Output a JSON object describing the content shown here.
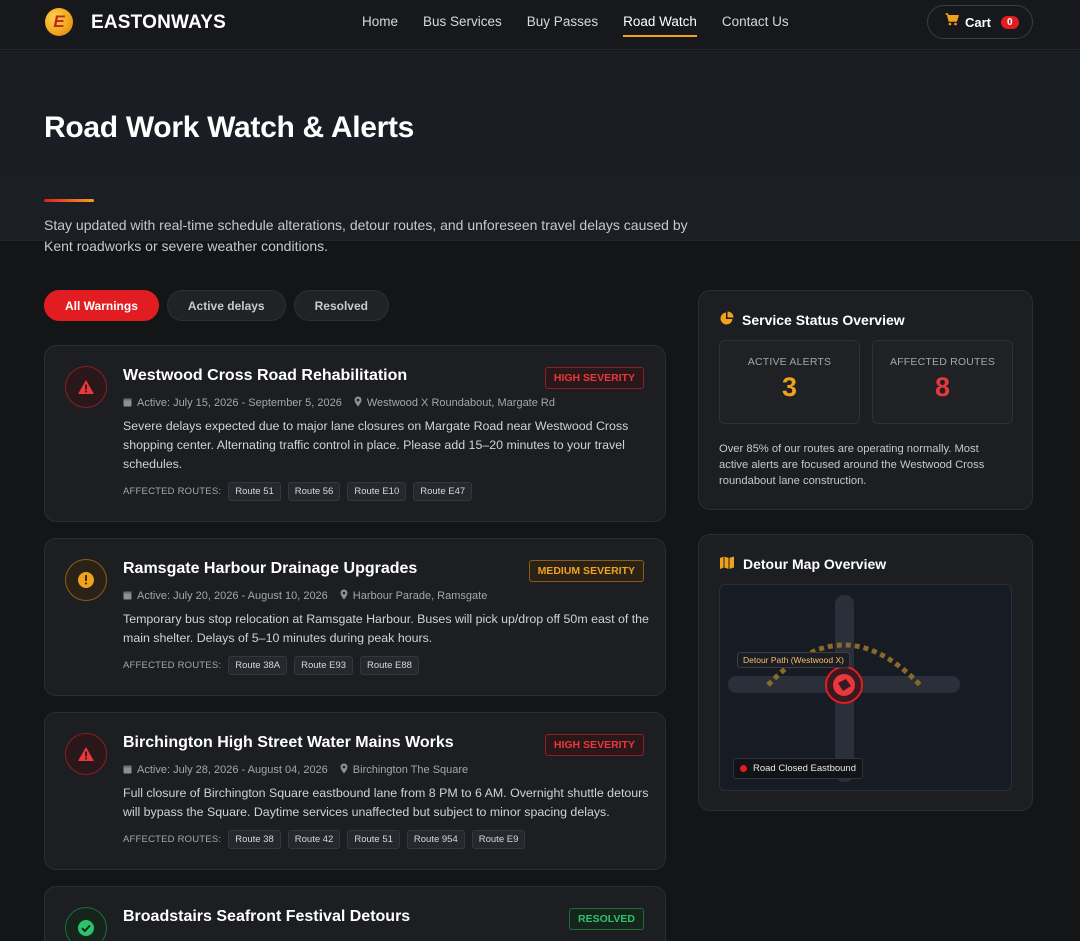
{
  "nav": {
    "logo_letter": "E",
    "brand": "EASTONWAYS",
    "links": [
      "Home",
      "Bus Services",
      "Buy Passes",
      "Road Watch",
      "Contact Us"
    ],
    "active_link": "Road Watch",
    "cart_label": "Cart",
    "cart_count": "0"
  },
  "hero": {
    "title": "Road Work Watch & Alerts",
    "subtitle": "Stay updated with real-time schedule alterations, detour routes, and unforeseen travel delays caused by Kent roadworks or severe weather conditions."
  },
  "filters": [
    "All Warnings",
    "Active delays",
    "Resolved"
  ],
  "alerts_routes_label": "AFFECTED ROUTES:",
  "alerts": [
    {
      "title": "Westwood Cross Road Rehabilitation",
      "severity": "HIGH SEVERITY",
      "dates": "Active: July 15, 2026 - September 5, 2026",
      "location": "Westwood X Roundabout, Margate Rd",
      "description": "Severe delays expected due to major lane closures on Margate Road near Westwood Cross shopping center. Alternating traffic control in place. Please add 15–20 minutes to your travel schedules.",
      "routes": [
        "Route 51",
        "Route 56",
        "Route E10",
        "Route E47"
      ]
    },
    {
      "title": "Ramsgate Harbour Drainage Upgrades",
      "severity": "MEDIUM SEVERITY",
      "dates": "Active: July 20, 2026 - August 10, 2026",
      "location": "Harbour Parade, Ramsgate",
      "description": "Temporary bus stop relocation at Ramsgate Harbour. Buses will pick up/drop off 50m east of the main shelter. Delays of 5–10 minutes during peak hours.",
      "routes": [
        "Route 38A",
        "Route E93",
        "Route E88"
      ]
    },
    {
      "title": "Birchington High Street Water Mains Works",
      "severity": "HIGH SEVERITY",
      "dates": "Active: July 28, 2026 - August 04, 2026",
      "location": "Birchington The Square",
      "description": "Full closure of Birchington Square eastbound lane from 8 PM to 6 AM. Overnight shuttle detours will bypass the Square. Daytime services unaffected but subject to minor spacing delays.",
      "routes": [
        "Route 38",
        "Route 42",
        "Route 51",
        "Route 954",
        "Route E9"
      ]
    },
    {
      "title": "Broadstairs Seafront Festival Detours",
      "severity": "RESOLVED"
    }
  ],
  "status": {
    "title": "Service Status Overview",
    "active_alerts_label": "ACTIVE ALERTS",
    "active_alerts_value": "3",
    "affected_routes_label": "AFFECTED ROUTES",
    "affected_routes_value": "8",
    "note": "Over 85% of our routes are operating normally. Most active alerts are focused around the Westwood Cross roundabout lane construction."
  },
  "map": {
    "title": "Detour Map Overview",
    "detour_tag": "Detour Path (Westwood X)",
    "legend": "Road Closed Eastbound"
  },
  "colors": {
    "accent_red": "#e11d22",
    "accent_amber": "#f0a21a",
    "resolved_green": "#2bc46a"
  }
}
